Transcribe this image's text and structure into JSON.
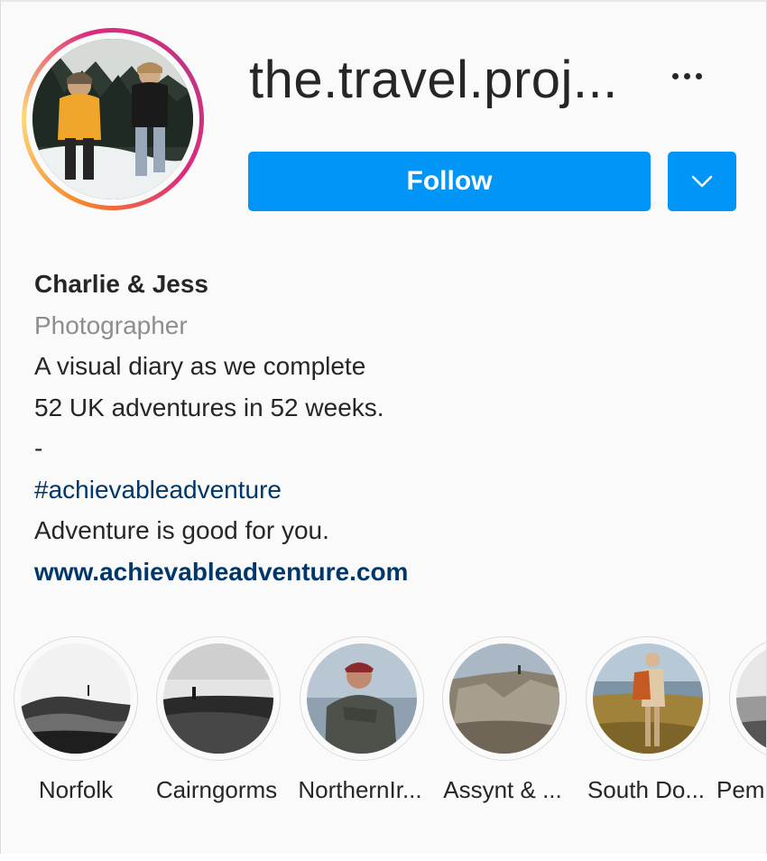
{
  "profile": {
    "username": "the.travel.proj...",
    "display_name": "Charlie & Jess",
    "category": "Photographer",
    "bio_lines": [
      "A visual diary as we complete",
      "52 UK adventures in 52 weeks.",
      "-"
    ],
    "hashtag": "#achievableadventure",
    "tagline": "Adventure is good for you.",
    "website": "www.achievableadventure.com"
  },
  "actions": {
    "follow_label": "Follow",
    "more_icon": "more-horizontal-icon",
    "dropdown_icon": "chevron-down-icon"
  },
  "highlights": [
    {
      "label": "Norfolk"
    },
    {
      "label": "Cairngorms"
    },
    {
      "label": "NorthernIr..."
    },
    {
      "label": "Assynt & ..."
    },
    {
      "label": "South Do..."
    },
    {
      "label": "Pem"
    }
  ],
  "colors": {
    "accent": "#0095f6",
    "link": "#00376b",
    "muted": "#8e8e8e",
    "text": "#262626",
    "background": "#fafafa"
  }
}
